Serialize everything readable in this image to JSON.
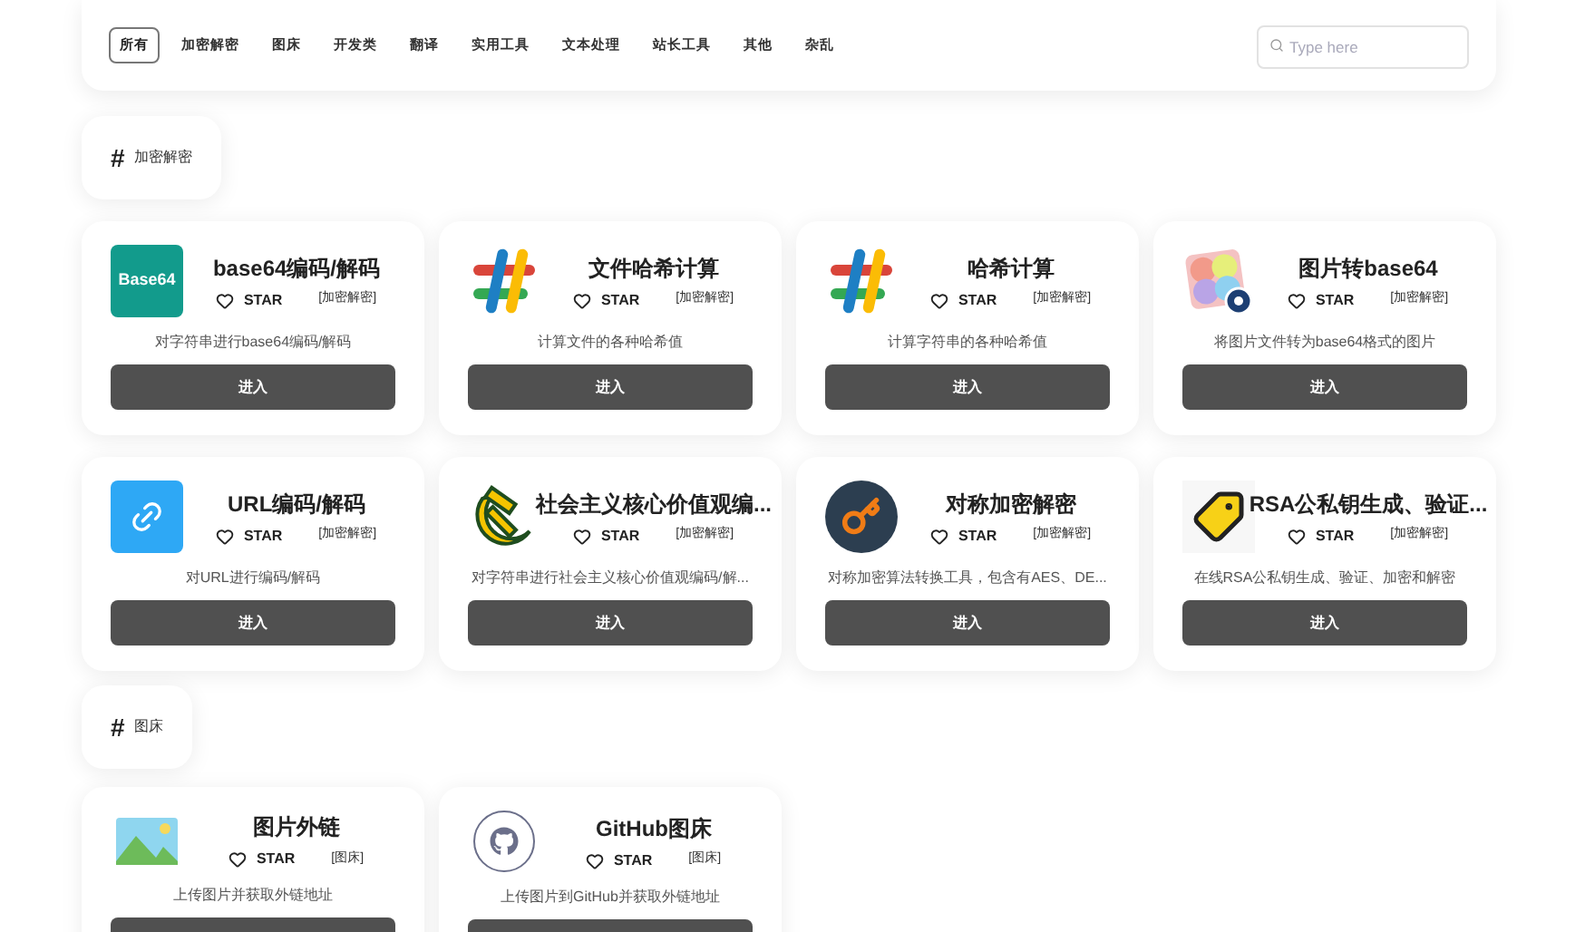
{
  "nav": {
    "tabs": [
      {
        "label": "所有",
        "selected": true
      },
      {
        "label": "加密解密",
        "selected": false
      },
      {
        "label": "图床",
        "selected": false
      },
      {
        "label": "开发类",
        "selected": false
      },
      {
        "label": "翻译",
        "selected": false
      },
      {
        "label": "实用工具",
        "selected": false
      },
      {
        "label": "文本处理",
        "selected": false
      },
      {
        "label": "站长工具",
        "selected": false
      },
      {
        "label": "其他",
        "selected": false
      },
      {
        "label": "杂乱",
        "selected": false
      }
    ],
    "search": {
      "placeholder": "Type here"
    }
  },
  "sections": [
    {
      "hash": "#",
      "title": "加密解密",
      "tools": [
        {
          "kind": "base64",
          "logo_text": "Base64",
          "title": "base64编码/解码",
          "star": "STAR",
          "tag": "[加密解密]",
          "description": "对字符串进行base64编码/解码",
          "button": "进入"
        },
        {
          "kind": "hash",
          "title": "文件哈希计算",
          "star": "STAR",
          "tag": "[加密解密]",
          "description": "计算文件的各种哈希值",
          "button": "进入"
        },
        {
          "kind": "hash",
          "title": "哈希计算",
          "star": "STAR",
          "tag": "[加密解密]",
          "description": "计算字符串的各种哈希值",
          "button": "进入"
        },
        {
          "kind": "photos",
          "title": "图片转base64",
          "star": "STAR",
          "tag": "[加密解密]",
          "description": "将图片文件转为base64格式的图片",
          "button": "进入"
        },
        {
          "kind": "link",
          "title": "URL编码/解码",
          "star": "STAR",
          "tag": "[加密解密]",
          "description": "对URL进行编码/解码",
          "button": "进入"
        },
        {
          "kind": "emblem",
          "title": "社会主义核心价值观编...",
          "star": "STAR",
          "tag": "[加密解密]",
          "description": "对字符串进行社会主义核心价值观编码/解...",
          "button": "进入"
        },
        {
          "kind": "key",
          "title": "对称加密解密",
          "star": "STAR",
          "tag": "[加密解密]",
          "description": "对称加密算法转换工具，包含有AES、DE...",
          "button": "进入"
        },
        {
          "kind": "tag",
          "title": "RSA公私钥生成、验证...",
          "star": "STAR",
          "tag": "[加密解密]",
          "description": "在线RSA公私钥生成、验证、加密和解密",
          "button": "进入"
        }
      ]
    },
    {
      "hash": "#",
      "title": "图床",
      "tools": [
        {
          "kind": "landscape",
          "title": "图片外链",
          "star": "STAR",
          "tag": "[图床]",
          "description": "上传图片并获取外链地址"
        },
        {
          "kind": "octocat",
          "title": "GitHub图床",
          "star": "STAR",
          "tag": "[图床]",
          "description": "上传图片到GitHub并获取外链地址"
        }
      ]
    }
  ]
}
